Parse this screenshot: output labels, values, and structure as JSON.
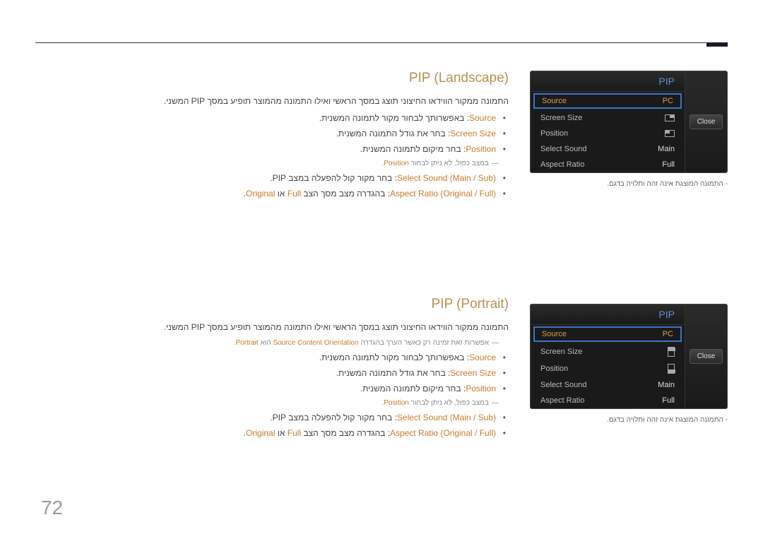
{
  "page_number": "72",
  "pip_box_1": {
    "title": "PIP",
    "rows": [
      {
        "label": "Source",
        "value": "PC",
        "highlighted": true
      },
      {
        "label": "Screen Size",
        "value": "",
        "icon": "tr"
      },
      {
        "label": "Position",
        "value": "",
        "icon": "tl"
      },
      {
        "label": "Select Sound",
        "value": "Main"
      },
      {
        "label": "Aspect Ratio",
        "value": "Full"
      }
    ],
    "close": "Close",
    "caption": "התמונה המוצגת אינה זהה ותלויה בדגם."
  },
  "pip_box_2": {
    "title": "PIP",
    "rows": [
      {
        "label": "Source",
        "value": "PC",
        "highlighted": true
      },
      {
        "label": "Screen Size",
        "value": "",
        "icon": "portrait-top"
      },
      {
        "label": "Position",
        "value": "",
        "icon": "portrait-bot"
      },
      {
        "label": "Select Sound",
        "value": "Main"
      },
      {
        "label": "Aspect Ratio",
        "value": "Full"
      }
    ],
    "close": "Close",
    "caption": "התמונה המוצגת אינה זהה ותלויה בדגם."
  },
  "section1": {
    "title": "PIP (Landscape)",
    "intro": "התמונה ממקור הווידאו החיצוני תוצג במסך הראשי ואילו התמונה מהמוצר תופיע במסך PIP המשני.",
    "items": [
      {
        "kw": "Source",
        "text": ": באפשרותך לבחור מקור לתמונה המשנית."
      },
      {
        "kw": "Screen Size",
        "text": ": בחר את גודל התמונה המשנית."
      },
      {
        "kw": "Position",
        "text": ": בחר מיקום לתמונה המשנית.",
        "note_pre": "במצב כפול, לא ניתן לבחור ",
        "note_kw": "Position",
        "note_post": "."
      },
      {
        "kw": "Select Sound",
        "mid": " (Main / Sub)",
        "text": ": בחר מקור קול להפעלה במצב PIP."
      },
      {
        "kw": "Aspect Ratio",
        "mid": " (Original / Full)",
        "text": ": בהגדרה מצב מסך הצב ",
        "end_kw": "Full",
        "end_or": " או ",
        "end_kw2": "Original",
        "end_dot": "."
      }
    ]
  },
  "section2": {
    "title": "PIP (Portrait)",
    "intro": "התמונה ממקור הווידאו החיצוני תוצג במסך הראשי ואילו התמונה מהמוצר תופיע במסך PIP המשני.",
    "note_pre": "אפשרות זאת זמינה רק כאשר הערך בהגדרה ",
    "note_kw": "Source Content Orientation",
    "note_mid": " הוא ",
    "note_kw2": "Portrait",
    "note_post": ".",
    "items": [
      {
        "kw": "Source",
        "text": ": באפשרותך לבחור מקור לתמונה המשנית."
      },
      {
        "kw": "Screen Size",
        "text": ": בחר את גודל התמונה המשנית."
      },
      {
        "kw": "Position",
        "text": ": בחר מיקום לתמונה המשנית.",
        "note_pre": "במצב כפול, לא ניתן לבחור ",
        "note_kw": "Position",
        "note_post": "."
      },
      {
        "kw": "Select Sound",
        "mid": " (Main / Sub)",
        "text": ": בחר מקור קול להפעלה במצב PIP."
      },
      {
        "kw": "Aspect Ratio",
        "mid": " (Original / Full)",
        "text": ": בהגדרה מצב מסך הצב ",
        "end_kw": "Full",
        "end_or": " או ",
        "end_kw2": "Original",
        "end_dot": "."
      }
    ]
  }
}
